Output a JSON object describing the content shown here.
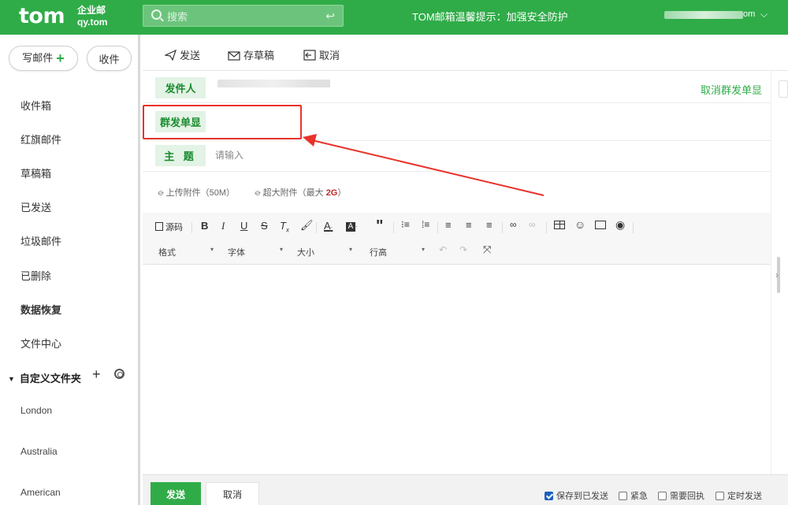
{
  "header": {
    "logo": "tom",
    "logo_sub_line1": "企业邮",
    "logo_sub_line2": "qy.tom",
    "search_placeholder": "搜索",
    "notice": "TOM邮箱温馨提示：加强安全防护",
    "account_suffix": "om",
    "colors": {
      "brand": "#2fac48"
    }
  },
  "sidebar": {
    "compose_label": "写邮件",
    "receive_label": "收件",
    "items": [
      {
        "label": "收件箱"
      },
      {
        "label": "红旗邮件"
      },
      {
        "label": "草稿箱"
      },
      {
        "label": "已发送"
      },
      {
        "label": "垃圾邮件"
      },
      {
        "label": "已删除"
      },
      {
        "label": "数据恢复"
      },
      {
        "label": "文件中心"
      }
    ],
    "custom_folder_label": "自定义文件夹",
    "sub_folders": [
      {
        "label": "London"
      },
      {
        "label": "Australia"
      },
      {
        "label": "American"
      }
    ]
  },
  "actionbar": {
    "send": "发送",
    "save_draft": "存草稿",
    "cancel": "取消"
  },
  "compose": {
    "sender_label": "发件人",
    "cancel_group_send": "取消群发单显",
    "group_single_label": "群发单显",
    "subject_label": "主  题",
    "subject_placeholder": "请输入",
    "upload_attachment": "上传附件（50M）",
    "large_attachment": "超大附件（最大 ",
    "large_attachment_size": "2G",
    "large_attachment_end": "）"
  },
  "toolbar": {
    "source": "源码",
    "format": "格式",
    "font": "字体",
    "size": "大小",
    "line_height": "行高"
  },
  "bottombar": {
    "send": "发送",
    "cancel": "取消",
    "options": [
      {
        "label": "保存到已发送",
        "checked": true
      },
      {
        "label": "紧急",
        "checked": false
      },
      {
        "label": "需要回执",
        "checked": false
      },
      {
        "label": "定时发送",
        "checked": false
      }
    ]
  }
}
